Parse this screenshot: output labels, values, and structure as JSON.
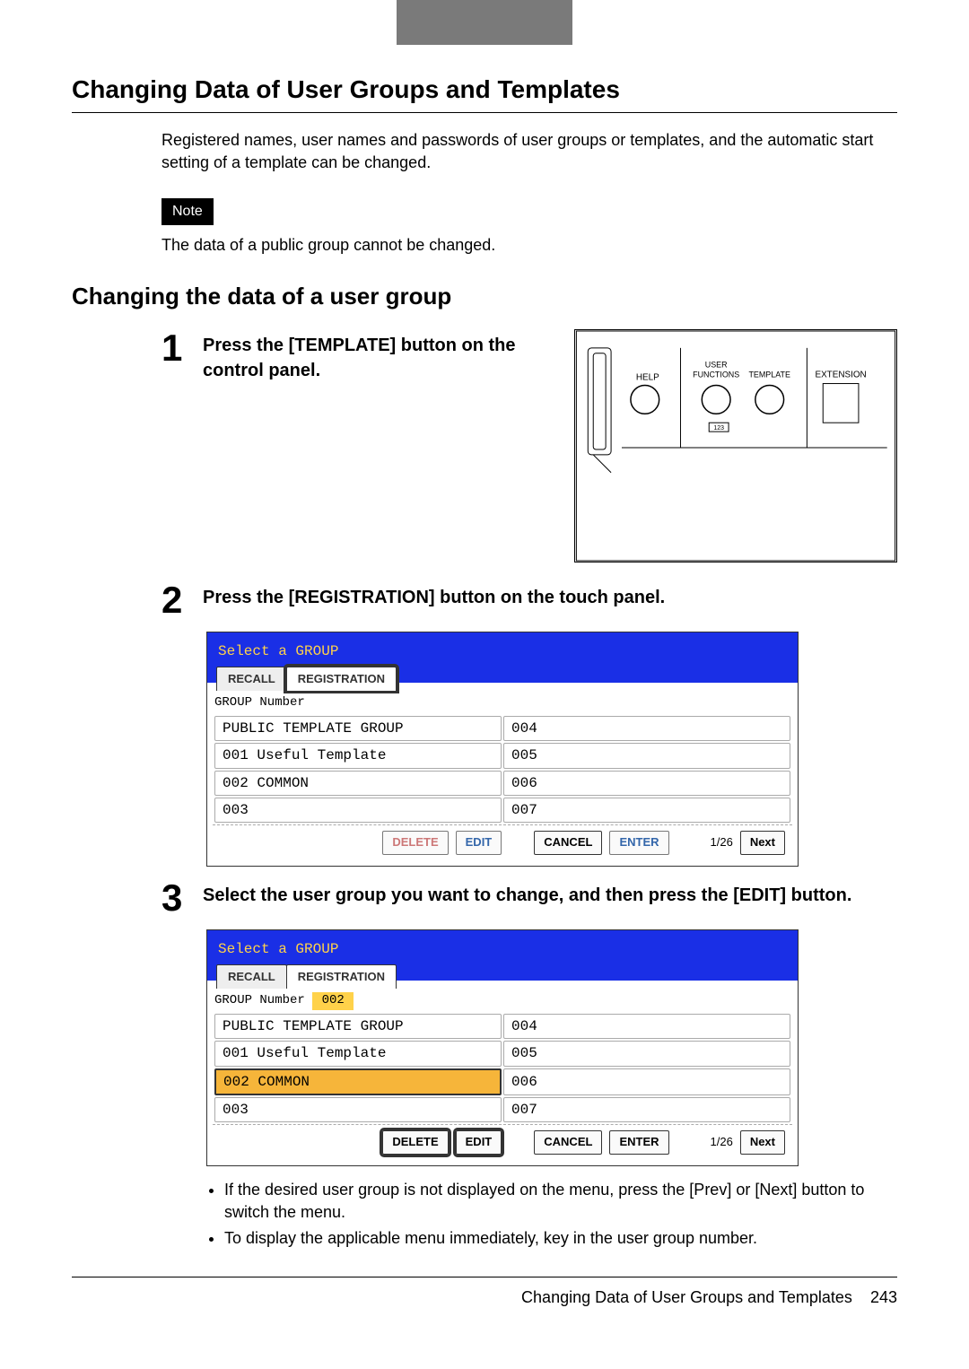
{
  "page": {
    "title": "Changing Data of User Groups and Templates",
    "intro": "Registered names, user names and passwords of user groups or templates, and the automatic start setting of a template can be changed.",
    "note_label": "Note",
    "note_text": "The data of a public group cannot be changed.",
    "subhead": "Changing the data of a user group",
    "footer_text": "Changing Data of User Groups and Templates",
    "footer_page": "243"
  },
  "steps": {
    "s1": {
      "num": "1",
      "text": "Press the [TEMPLATE] button on the control panel."
    },
    "s2": {
      "num": "2",
      "text": "Press the [REGISTRATION] button on the touch panel."
    },
    "s3": {
      "num": "3",
      "text": "Select the user group you want to change, and then press the [EDIT] button."
    }
  },
  "panel": {
    "help": "HELP",
    "user_functions": "USER\nFUNCTIONS",
    "template": "TEMPLATE",
    "extension": "EXTENSION"
  },
  "screen2": {
    "title": "Select a GROUP",
    "tab_recall": "RECALL",
    "tab_registration": "REGISTRATION",
    "group_number_label": "GROUP Number",
    "group_number_value": "",
    "rows_left": [
      "PUBLIC TEMPLATE GROUP",
      "001 Useful Template",
      "002 COMMON",
      "003"
    ],
    "rows_right": [
      "004",
      "005",
      "006",
      "007"
    ],
    "btn_delete": "DELETE",
    "btn_edit": "EDIT",
    "btn_cancel": "CANCEL",
    "btn_enter": "ENTER",
    "page": "1/26",
    "btn_next": "Next"
  },
  "screen3": {
    "title": "Select a GROUP",
    "tab_recall": "RECALL",
    "tab_registration": "REGISTRATION",
    "group_number_label": "GROUP Number",
    "group_number_value": "002",
    "rows_left": [
      "PUBLIC TEMPLATE GROUP",
      "001 Useful Template",
      "002 COMMON",
      "003"
    ],
    "rows_right": [
      "004",
      "005",
      "006",
      "007"
    ],
    "selected_index": 2,
    "btn_delete": "DELETE",
    "btn_edit": "EDIT",
    "btn_cancel": "CANCEL",
    "btn_enter": "ENTER",
    "page": "1/26",
    "btn_next": "Next"
  },
  "tips": {
    "t1": "If the desired user group is not displayed on the menu, press the [Prev] or [Next] button to switch the menu.",
    "t2": "To display the applicable menu immediately, key in the user group number."
  }
}
